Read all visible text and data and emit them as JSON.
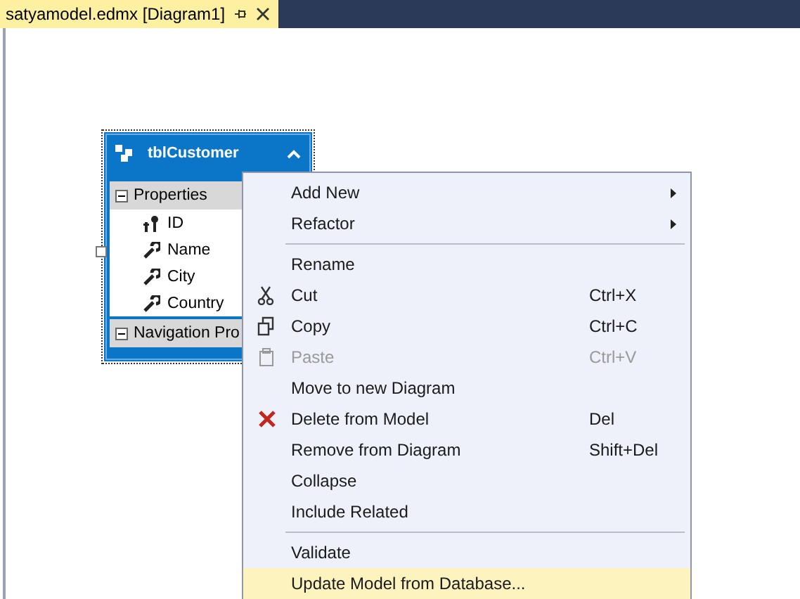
{
  "tab": {
    "title": "satyamodel.edmx [Diagram1]",
    "selected": true
  },
  "entity": {
    "name": "tblCustomer",
    "expanded": true,
    "sections": [
      {
        "title": "Properties",
        "expanded": true,
        "items": [
          {
            "name": "ID",
            "kind": "key"
          },
          {
            "name": "Name",
            "kind": "property"
          },
          {
            "name": "City",
            "kind": "property"
          },
          {
            "name": "Country",
            "kind": "property"
          }
        ]
      },
      {
        "title": "Navigation Pro",
        "expanded": true
      }
    ]
  },
  "menu": [
    {
      "kind": "submenu",
      "label": "Add New",
      "disabled": false,
      "selected": false
    },
    {
      "kind": "submenu",
      "label": "Refactor",
      "disabled": false,
      "selected": false
    },
    {
      "kind": "separator"
    },
    {
      "kind": "command",
      "label": "Rename",
      "disabled": false,
      "selected": false
    },
    {
      "kind": "command",
      "label": "Cut",
      "shortcut": "Ctrl+X",
      "disabled": false,
      "selected": false
    },
    {
      "kind": "command",
      "label": "Copy",
      "shortcut": "Ctrl+C",
      "disabled": false,
      "selected": false
    },
    {
      "kind": "command",
      "label": "Paste",
      "shortcut": "Ctrl+V",
      "disabled": true,
      "selected": false
    },
    {
      "kind": "command",
      "label": "Move to new Diagram",
      "disabled": false,
      "selected": false
    },
    {
      "kind": "command",
      "label": "Delete from Model",
      "shortcut": "Del",
      "disabled": false,
      "selected": false
    },
    {
      "kind": "command",
      "label": "Remove from Diagram",
      "shortcut": "Shift+Del",
      "disabled": false,
      "selected": false
    },
    {
      "kind": "command",
      "label": "Collapse",
      "disabled": false,
      "selected": false
    },
    {
      "kind": "command",
      "label": "Include Related",
      "disabled": false,
      "selected": false
    },
    {
      "kind": "separator"
    },
    {
      "kind": "command",
      "label": "Validate",
      "disabled": false,
      "selected": false
    },
    {
      "kind": "command",
      "label": "Update Model from Database...",
      "disabled": false,
      "selected": true
    }
  ]
}
